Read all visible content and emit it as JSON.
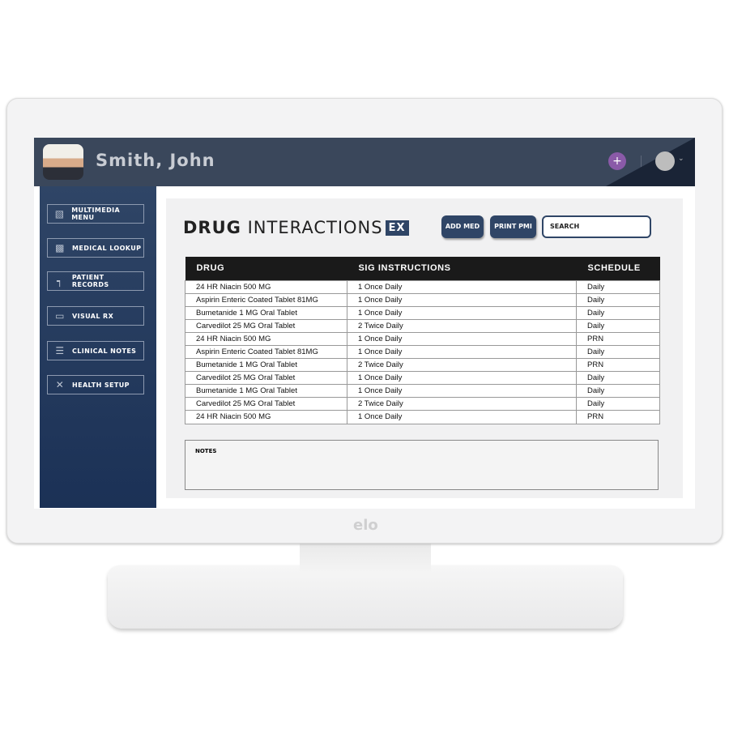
{
  "patient": {
    "name": "Smith, John"
  },
  "sidebar": {
    "items": [
      {
        "label": "MULTIMEDIA MENU",
        "icon": "multimedia-icon"
      },
      {
        "label": "MEDICAL LOOKUP",
        "icon": "chart-lookup-icon"
      },
      {
        "label": "PATIENT RECORDS",
        "icon": "folder-icon"
      },
      {
        "label": "VISUAL RX",
        "icon": "window-icon"
      },
      {
        "label": "CLINICAL NOTES",
        "icon": "list-icon"
      },
      {
        "label": "HEALTH SETUP",
        "icon": "tools-icon"
      }
    ]
  },
  "main": {
    "title_bold": "DRUG",
    "title_light": "INTERACTIONS",
    "title_badge": "EX",
    "add_med": "ADD MED",
    "print_pmi": "PRINT PMI",
    "search_placeholder": "SEARCH",
    "columns": [
      "DRUG",
      "SIG INSTRUCTIONS",
      "SCHEDULE"
    ],
    "rows": [
      [
        "24 HR Niacin 500 MG",
        "1 Once Daily",
        "Daily"
      ],
      [
        "Aspirin Enteric Coated Tablet 81MG",
        "1 Once Daily",
        "Daily"
      ],
      [
        "Bumetanide 1 MG Oral Tablet",
        "1 Once Daily",
        "Daily"
      ],
      [
        "Carvedilot 25 MG Oral Tablet",
        "2 Twice Daily",
        "Daily"
      ],
      [
        "24 HR Niacin 500 MG",
        "1 Once Daily",
        "PRN"
      ],
      [
        "Aspirin Enteric Coated Tablet 81MG",
        "1 Once Daily",
        "Daily"
      ],
      [
        "Bumetanide 1 MG Oral Tablet",
        "2 Twice Daily",
        "PRN"
      ],
      [
        "Carvedilot 25 MG Oral Tablet",
        "1 Once Daily",
        "Daily"
      ],
      [
        "Bumetanide 1 MG Oral Tablet",
        "1 Once Daily",
        "Daily"
      ],
      [
        "Carvedilot 25 MG Oral Tablet",
        "2 Twice Daily",
        "Daily"
      ],
      [
        "24 HR Niacin 500 MG",
        "1 Once Daily",
        "PRN"
      ]
    ],
    "notes_label": "NOTES"
  },
  "brand": "elo",
  "colors": {
    "header": "#3a475b",
    "sidebar": "#2f4566",
    "accent_plus": "#8a5aa8"
  }
}
